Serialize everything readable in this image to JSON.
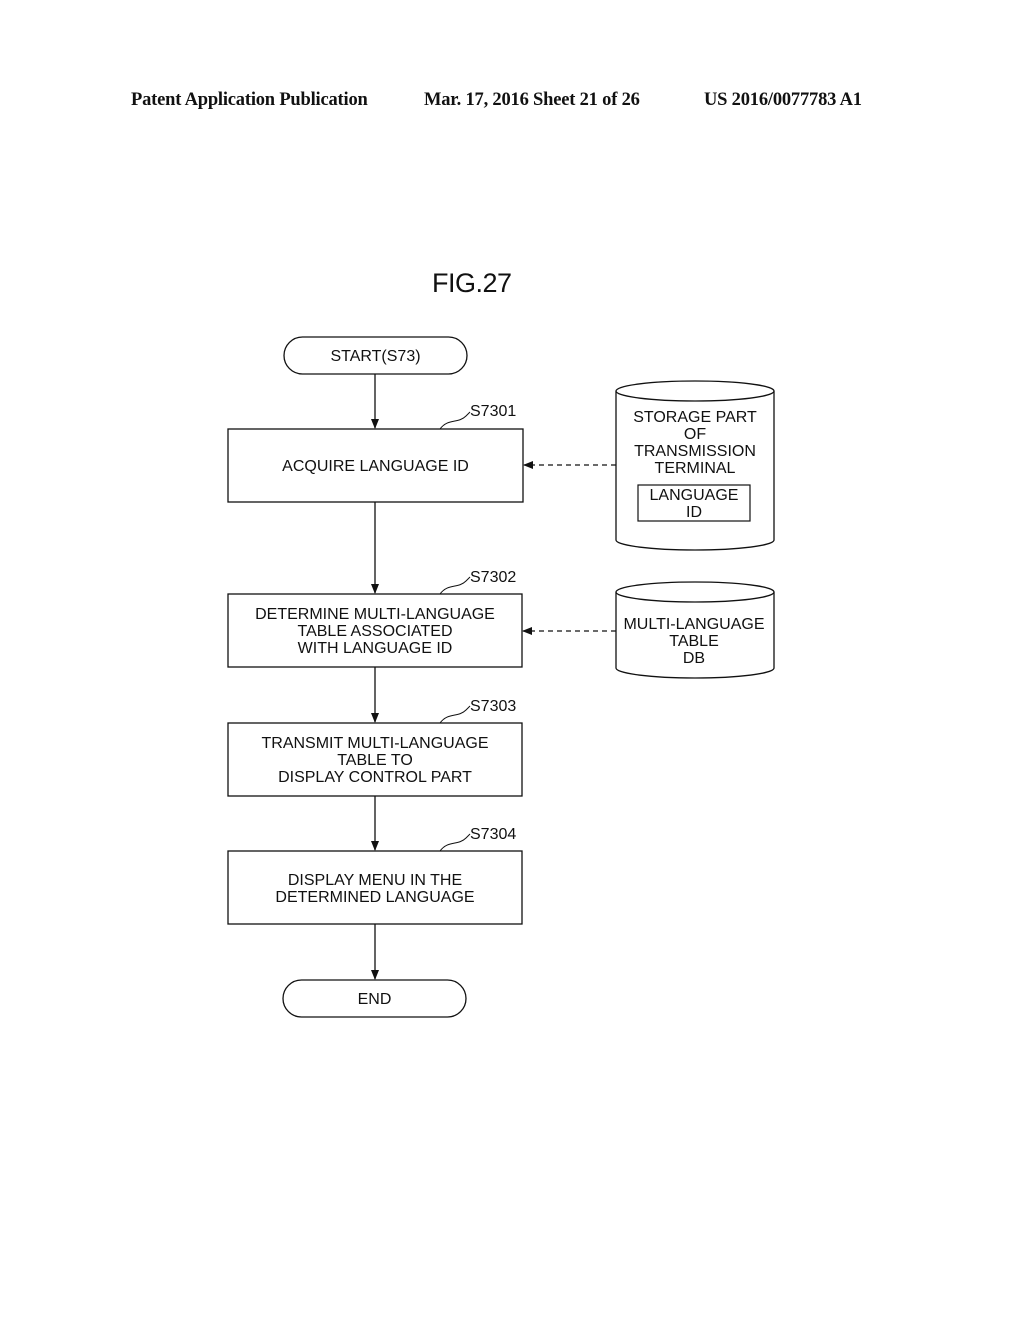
{
  "header": {
    "publication": "Patent Application Publication",
    "date_sheet": "Mar. 17, 2016  Sheet 21 of 26",
    "number": "US 2016/0077783 A1"
  },
  "figure": {
    "title": "FIG.27"
  },
  "flowchart": {
    "start": "START(S73)",
    "end": "END",
    "steps": [
      {
        "id": "S7301",
        "lines": [
          "ACQUIRE LANGUAGE ID"
        ]
      },
      {
        "id": "S7302",
        "lines": [
          "DETERMINE MULTI-LANGUAGE",
          "TABLE ASSOCIATED",
          "WITH LANGUAGE ID"
        ]
      },
      {
        "id": "S7303",
        "lines": [
          "TRANSMIT MULTI-LANGUAGE",
          "TABLE TO",
          "DISPLAY CONTROL PART"
        ]
      },
      {
        "id": "S7304",
        "lines": [
          "DISPLAY MENU IN THE",
          "DETERMINED LANGUAGE"
        ]
      }
    ],
    "stores": [
      {
        "lines": [
          "STORAGE PART",
          "OF",
          "TRANSMISSION",
          "TERMINAL"
        ],
        "inner_box": [
          "LANGUAGE",
          "ID"
        ],
        "feeds_step": "S7301"
      },
      {
        "lines": [
          "MULTI-LANGUAGE",
          "TABLE",
          "DB"
        ],
        "feeds_step": "S7302"
      }
    ]
  }
}
